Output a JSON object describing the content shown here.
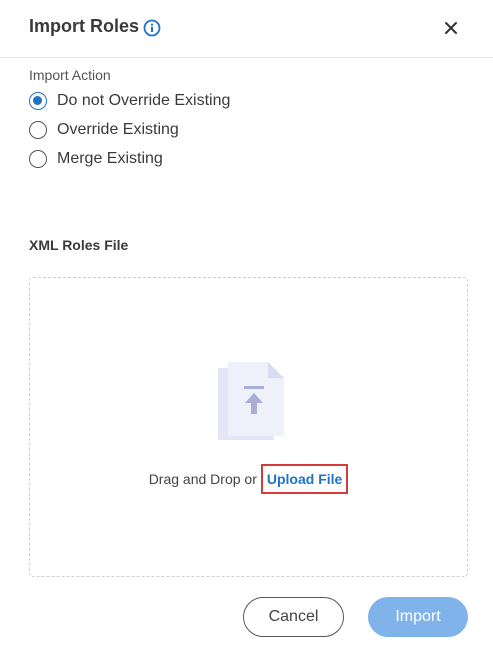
{
  "dialog": {
    "title": "Import Roles",
    "info_icon": "info-circle-icon",
    "close_icon": "close-icon"
  },
  "import_action": {
    "label": "Import Action",
    "options": [
      {
        "label": "Do not Override Existing",
        "checked": true
      },
      {
        "label": "Override Existing",
        "checked": false
      },
      {
        "label": "Merge Existing",
        "checked": false
      }
    ]
  },
  "file_section": {
    "label": "XML Roles File",
    "drop_text": "Drag and Drop or",
    "upload_link": "Upload File",
    "file_icon": "file-upload-icon"
  },
  "buttons": {
    "cancel": "Cancel",
    "import": "Import"
  },
  "colors": {
    "accent": "#1f73c7",
    "import_button": "#7fb3ea",
    "highlight_border": "#d63b3b"
  }
}
